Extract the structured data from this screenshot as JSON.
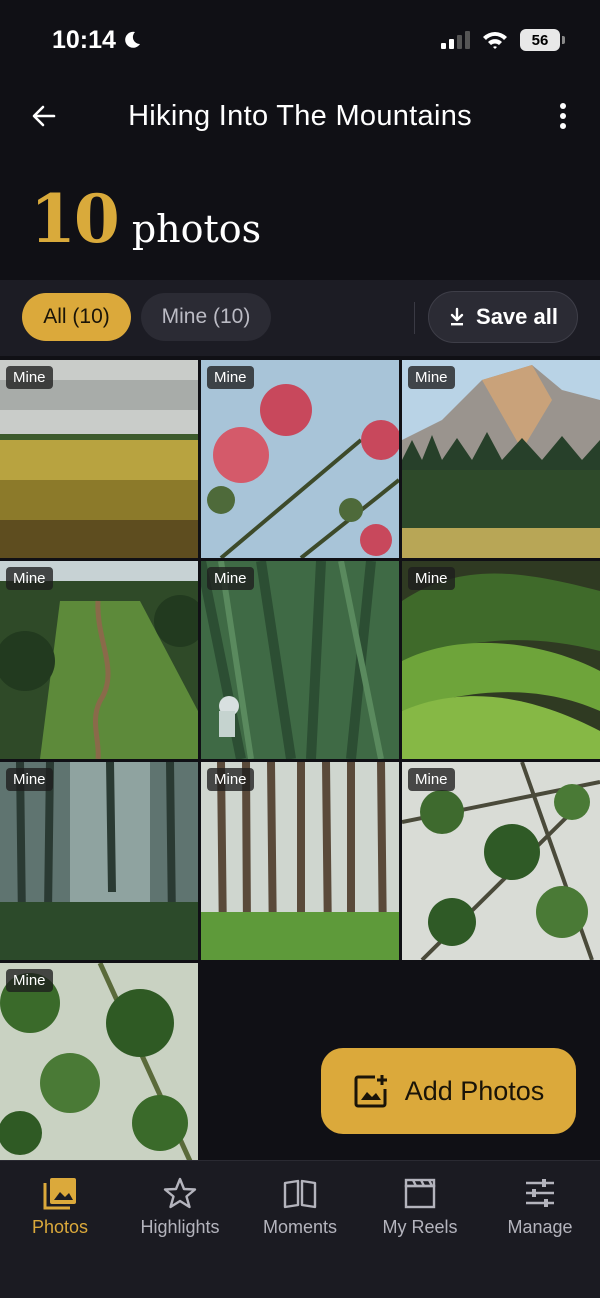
{
  "status": {
    "time": "10:14",
    "battery": "56"
  },
  "header": {
    "title": "Hiking Into The Mountains"
  },
  "summary": {
    "count": "10",
    "label": "photos"
  },
  "filters": {
    "all_label": "All (10)",
    "mine_label": "Mine (10)",
    "save_all_label": "Save all"
  },
  "photos": [
    {
      "badge": "Mine",
      "icon": "wheat-field"
    },
    {
      "badge": "Mine",
      "icon": "pink-flowers"
    },
    {
      "badge": "Mine",
      "icon": "half-dome-mountain"
    },
    {
      "badge": "Mine",
      "icon": "ridge-trail"
    },
    {
      "badge": "Mine",
      "icon": "green-forest-hiker"
    },
    {
      "badge": "Mine",
      "icon": "green-hills"
    },
    {
      "badge": "Mine",
      "icon": "misty-forest"
    },
    {
      "badge": "Mine",
      "icon": "pine-trunks"
    },
    {
      "badge": "Mine",
      "icon": "leafy-branches"
    },
    {
      "badge": "Mine",
      "icon": "bamboo-leaves"
    }
  ],
  "fab": {
    "label": "Add Photos",
    "icon": "add-photo-icon"
  },
  "nav": [
    {
      "label": "Photos",
      "icon": "photos-icon",
      "active": true
    },
    {
      "label": "Highlights",
      "icon": "star-icon"
    },
    {
      "label": "Moments",
      "icon": "book-icon"
    },
    {
      "label": "My Reels",
      "icon": "clapper-icon"
    },
    {
      "label": "Manage",
      "icon": "sliders-icon"
    }
  ],
  "colors": {
    "accent": "#dba93b",
    "background": "#101015"
  }
}
